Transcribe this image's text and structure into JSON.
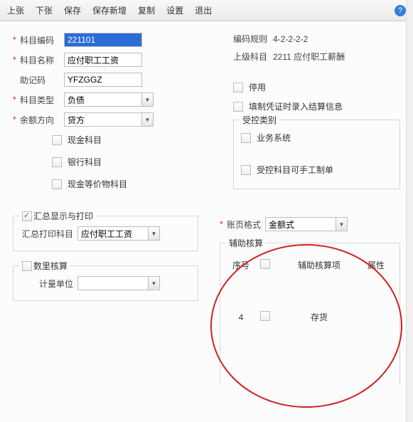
{
  "toolbar": {
    "prev": "上张",
    "next": "下张",
    "save": "保存",
    "saveNew": "保存新增",
    "copy": "复制",
    "settings": "设置",
    "exit": "退出",
    "help": "?"
  },
  "form": {
    "codeLabel": "科目编码",
    "codeValue": "221101",
    "nameLabel": "科目名称",
    "nameValue": "应付职工工资",
    "mnemonicLabel": "助记码",
    "mnemonicValue": "YFZGGZ",
    "typeLabel": "科目类型",
    "typeValue": "负债",
    "directionLabel": "余额方向",
    "directionValue": "贷方",
    "ruleLabel": "编码规则",
    "ruleValue": "4-2-2-2-2",
    "parentLabel": "上级科目",
    "parentValue": "2211 应付职工薪酬",
    "disable": "停用",
    "fillSettlement": "填制凭证时录入结算信息"
  },
  "cash": {
    "cashAcct": "现金科目",
    "bankAcct": "银行科目",
    "cashEquiv": "现金等价物科目"
  },
  "controlled": {
    "legend": "受控类别",
    "bizSystem": "业务系统",
    "manual": "受控科目可手工制单"
  },
  "summary": {
    "legend": "汇总显示与打印",
    "printLabel": "汇总打印科目",
    "printValue": "应付职工工资"
  },
  "qty": {
    "legend": "数里核算",
    "unitLabel": "计量单位",
    "unitValue": ""
  },
  "acct": {
    "formatLabel": "账页格式",
    "formatValue": "金额式"
  },
  "aux": {
    "legend": "辅助核算",
    "col1": "序号",
    "col2": "",
    "col3": "辅助核算项",
    "col4": "属性",
    "row": {
      "seq": "4",
      "item": "存货",
      "attr": ""
    }
  }
}
